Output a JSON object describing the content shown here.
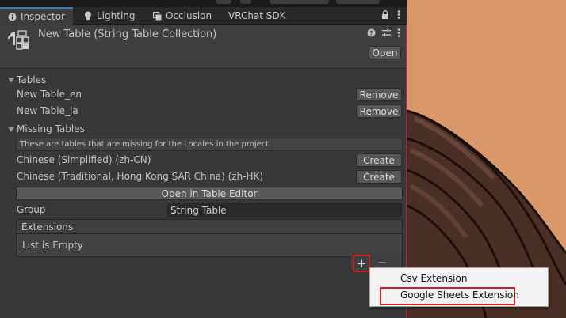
{
  "tabs": [
    {
      "label": "Inspector",
      "icon": "info-icon",
      "active": true
    },
    {
      "label": "Lighting",
      "icon": "lightbulb-icon",
      "active": false
    },
    {
      "label": "Occlusion",
      "icon": "occlusion-icon",
      "active": false
    },
    {
      "label": "VRChat SDK",
      "icon": "",
      "active": false
    }
  ],
  "tab_tools": {
    "lock": "lock-icon",
    "menu": "kebab-menu-icon"
  },
  "header": {
    "title": "New Table (String Table Collection)",
    "open_label": "Open",
    "tools": [
      "help-icon",
      "settings-sliders-icon",
      "kebab-menu-icon"
    ]
  },
  "tables": {
    "label": "Tables",
    "items": [
      {
        "name": "New Table_en",
        "action": "Remove"
      },
      {
        "name": "New Table_ja",
        "action": "Remove"
      }
    ]
  },
  "missing_tables": {
    "label": "Missing Tables",
    "note": "These are tables that are missing for the Locales in the project.",
    "items": [
      {
        "name": "Chinese (Simplified) (zh-CN)",
        "action": "Create"
      },
      {
        "name": "Chinese (Traditional, Hong Kong SAR China) (zh-HK)",
        "action": "Create"
      }
    ]
  },
  "open_table_editor_label": "Open in Table Editor",
  "group": {
    "label": "Group",
    "value": "String Table"
  },
  "extensions": {
    "label": "Extensions",
    "empty_text": "List is Empty",
    "add_symbol": "+",
    "remove_symbol": "−"
  },
  "menu": {
    "items": [
      "Csv Extension",
      "Google Sheets Extension"
    ],
    "highlighted": "Google Sheets Extension"
  },
  "colors": {
    "highlight_box": "#d32020",
    "active_tab_accent": "#3a79bb",
    "panel_bg": "#383838",
    "scene_bg": "#d9986a"
  }
}
